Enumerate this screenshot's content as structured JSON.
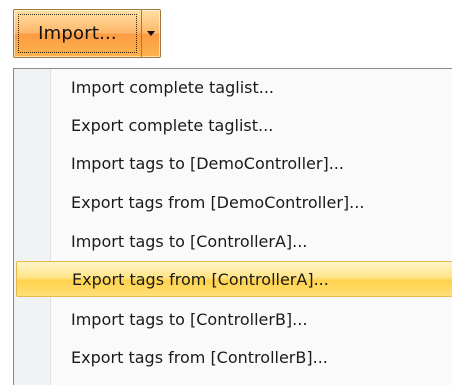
{
  "import_button": {
    "label": "Import..."
  },
  "menu": {
    "items": [
      {
        "label": "Import complete taglist...",
        "selected": false
      },
      {
        "label": "Export complete taglist...",
        "selected": false
      },
      {
        "label": "Import tags to [DemoController]...",
        "selected": false
      },
      {
        "label": "Export tags from [DemoController]...",
        "selected": false
      },
      {
        "label": "Import tags to [ControllerA]...",
        "selected": false
      },
      {
        "label": "Export tags from [ControllerA]...",
        "selected": true
      },
      {
        "label": "Import tags to [ControllerB]...",
        "selected": false
      },
      {
        "label": "Export tags from [ControllerB]...",
        "selected": false
      }
    ]
  },
  "colors": {
    "button_accent": "#fb9c43",
    "highlight": "#ffd24a"
  }
}
